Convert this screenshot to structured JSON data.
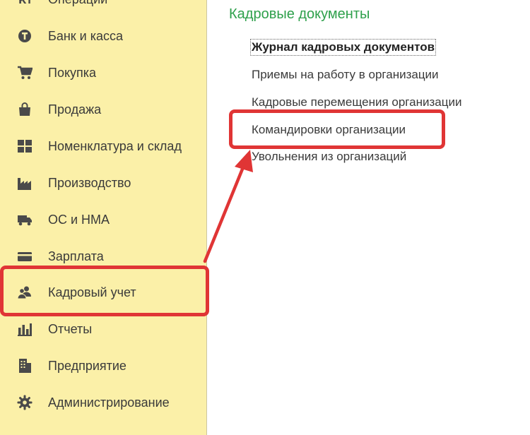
{
  "sidebar": {
    "items": [
      {
        "label": "Операции",
        "icon": "operations-icon"
      },
      {
        "label": "Банк и касса",
        "icon": "bank-coin-icon"
      },
      {
        "label": "Покупка",
        "icon": "shopping-cart-icon"
      },
      {
        "label": "Продажа",
        "icon": "shopping-bag-icon"
      },
      {
        "label": "Номенклатура и склад",
        "icon": "grid-icon"
      },
      {
        "label": "Производство",
        "icon": "factory-icon"
      },
      {
        "label": "ОС и НМА",
        "icon": "truck-icon"
      },
      {
        "label": "Зарплата",
        "icon": "wallet-icon"
      },
      {
        "label": "Кадровый учет",
        "icon": "users-icon"
      },
      {
        "label": "Отчеты",
        "icon": "bar-chart-icon"
      },
      {
        "label": "Предприятие",
        "icon": "building-icon"
      },
      {
        "label": "Администрирование",
        "icon": "gear-icon"
      }
    ],
    "highlighted_item": "Кадровый учет"
  },
  "content": {
    "title": "Кадровые документы",
    "links": [
      {
        "label": "Журнал кадровых документов",
        "bold": true
      },
      {
        "label": "Приемы на работу в организации",
        "bold": false
      },
      {
        "label": "Кадровые перемещения организации",
        "bold": false
      },
      {
        "label": "Командировки организации",
        "bold": false
      },
      {
        "label": "Увольнения из организаций",
        "bold": false
      }
    ],
    "highlighted_link": "Командировки организации"
  },
  "colors": {
    "sidebar_bg": "#fbf0a8",
    "title_green": "#2ea04b",
    "highlight_red": "#e03535",
    "icon_dark": "#4a4a4a"
  }
}
